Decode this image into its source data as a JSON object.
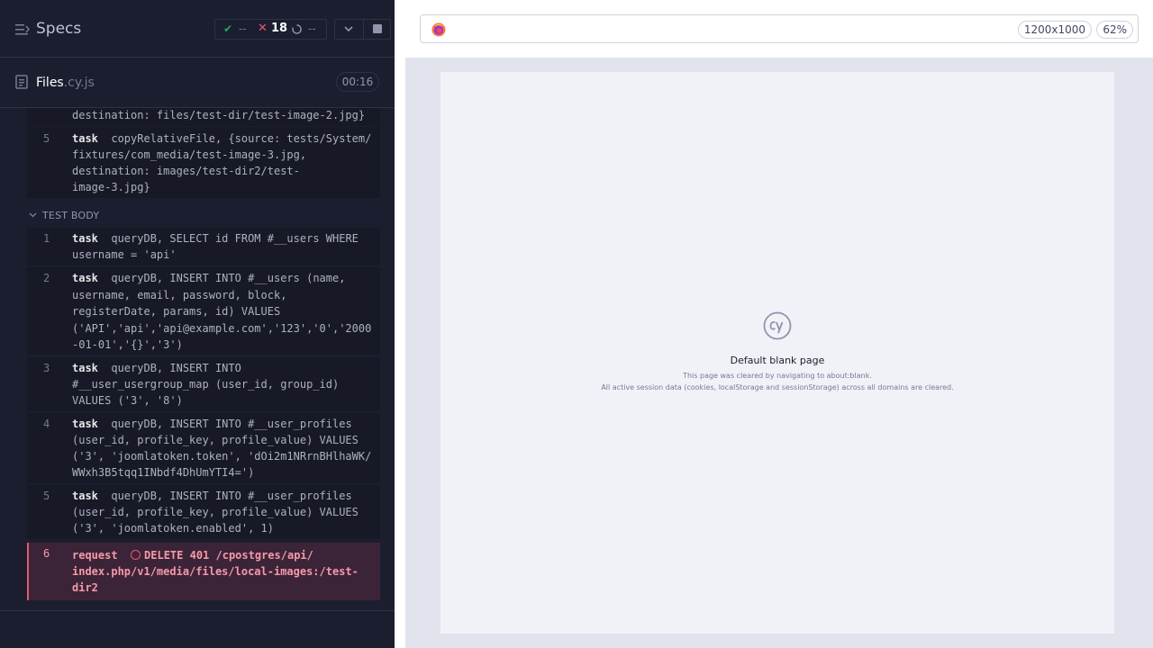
{
  "header": {
    "title": "Specs",
    "stats": {
      "passed": "--",
      "failed": "18",
      "pending": "--"
    }
  },
  "file": {
    "name": "Files",
    "ext": ".cy.js",
    "duration": "00:16"
  },
  "before_commands": [
    {
      "text": "destination: files/test-dir/test-image-2.jpg}"
    },
    {
      "num": "5",
      "name": "task",
      "text": "copyRelativeFile, {source: tests/System/\nfixtures/com_media/test-image-3.jpg,\ndestination: images/test-dir2/test-\nimage-3.jpg}"
    }
  ],
  "test_body": {
    "label": "TEST BODY",
    "commands": [
      {
        "num": "1",
        "name": "task",
        "text": "queryDB, SELECT id FROM #__users WHERE\nusername = 'api'"
      },
      {
        "num": "2",
        "name": "task",
        "text": "queryDB, INSERT INTO #__users (name,\nusername, email, password, block,\nregisterDate, params, id) VALUES\n('API','api','api@example.com','123','0','2000\n-01-01','{}','3')"
      },
      {
        "num": "3",
        "name": "task",
        "text": "queryDB, INSERT INTO\n#__user_usergroup_map (user_id, group_id)\nVALUES ('3', '8')"
      },
      {
        "num": "4",
        "name": "task",
        "text": "queryDB, INSERT INTO #__user_profiles\n(user_id, profile_key, profile_value) VALUES\n('3', 'joomlatoken.token', 'dOi2m1NRrnBHlhaWK/\nWWxh3B5tqq1INbdf4DhUmYTI4=')"
      },
      {
        "num": "5",
        "name": "task",
        "text": "queryDB, INSERT INTO #__user_profiles\n(user_id, profile_key, profile_value) VALUES\n('3', 'joomlatoken.enabled', 1)"
      },
      {
        "num": "6",
        "name": "request",
        "text": "DELETE 401 /cpostgres/api/\nindex.php/v1/media/files/local-images:/test-\ndir2",
        "status": "failed"
      }
    ]
  },
  "aut": {
    "viewport": "1200x1000",
    "zoom": "62%",
    "blank_title": "Default blank page",
    "blank_line1": "This page was cleared by navigating to about:blank.",
    "blank_line2": "All active session data (cookies, localStorage and sessionStorage) across all domains are cleared."
  },
  "colors": {
    "passed": "#1fa971",
    "failed": "#e45770",
    "panel_bg": "#1b1e2e"
  },
  "icons": [
    "specs-menu-icon",
    "check-icon",
    "x-icon",
    "spinner-icon",
    "chevron-down-icon",
    "stop-icon",
    "file-icon",
    "firefox-icon",
    "cy-logo-icon"
  ]
}
